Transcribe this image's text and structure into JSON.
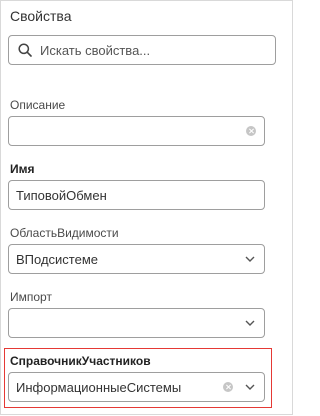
{
  "panel": {
    "title": "Свойства"
  },
  "search": {
    "placeholder": "Искать свойства..."
  },
  "fields": [
    {
      "label": "Описание",
      "value": "",
      "control": "text-clearable"
    },
    {
      "label": "Имя",
      "value": "ТиповойОбмен",
      "control": "text"
    },
    {
      "label": "ОбластьВидимости",
      "value": "ВПодсистеме",
      "control": "select"
    },
    {
      "label": "Импорт",
      "value": "",
      "control": "select"
    },
    {
      "label": "СправочникУчастников",
      "value": "ИнформационныеСистемы",
      "control": "select-clearable",
      "highlighted": true
    }
  ],
  "colors": {
    "highlight_border": "#e53935",
    "input_border": "#9e9e9e"
  }
}
